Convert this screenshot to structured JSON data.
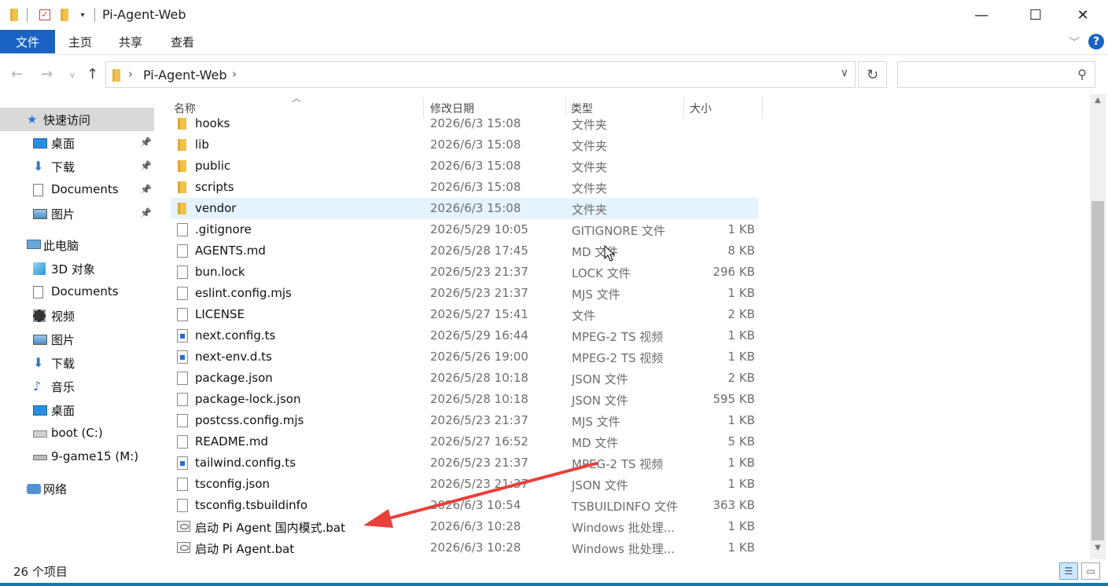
{
  "window": {
    "title": "Pi-Agent-Web",
    "minimize_glyph": "—",
    "maximize_glyph": "☐",
    "close_glyph": "✕"
  },
  "ribbon": {
    "tabs": [
      "文件",
      "主页",
      "共享",
      "查看"
    ],
    "active_color": "#1a63c2"
  },
  "address": {
    "path": "Pi-Agent-Web",
    "search_placeholder": ""
  },
  "sidebar": {
    "items": [
      {
        "label": "快速访问",
        "icon": "star-icon",
        "selected": true,
        "pinned": false
      },
      {
        "label": "桌面",
        "icon": "desktop-icon",
        "pinned": true
      },
      {
        "label": "下载",
        "icon": "download-icon",
        "pinned": true
      },
      {
        "label": "Documents",
        "icon": "documents-icon",
        "pinned": true
      },
      {
        "label": "图片",
        "icon": "pictures-icon",
        "pinned": true
      },
      {
        "label": "此电脑",
        "icon": "computer-icon",
        "pinned": false
      },
      {
        "label": "3D 对象",
        "icon": "3d-objects-icon",
        "pinned": false
      },
      {
        "label": "Documents",
        "icon": "documents-icon",
        "pinned": false
      },
      {
        "label": "视频",
        "icon": "video-icon",
        "pinned": false
      },
      {
        "label": "图片",
        "icon": "pictures-icon",
        "pinned": false
      },
      {
        "label": "下载",
        "icon": "download-icon",
        "pinned": false
      },
      {
        "label": "音乐",
        "icon": "music-icon",
        "pinned": false
      },
      {
        "label": "桌面",
        "icon": "desktop-icon",
        "pinned": false
      },
      {
        "label": "boot (C:)",
        "icon": "drive-c-icon",
        "pinned": false
      },
      {
        "label": "9-game15 (M:)",
        "icon": "drive-icon",
        "pinned": false
      },
      {
        "label": "网络",
        "icon": "network-icon",
        "pinned": false
      }
    ]
  },
  "columns": {
    "name": "名称",
    "date": "修改日期",
    "type": "类型",
    "size": "大小"
  },
  "files": [
    {
      "name": "hooks",
      "date": "2026/6/3 15:08",
      "type": "文件夹",
      "size": "",
      "icon": "folder"
    },
    {
      "name": "lib",
      "date": "2026/6/3 15:08",
      "type": "文件夹",
      "size": "",
      "icon": "folder"
    },
    {
      "name": "public",
      "date": "2026/6/3 15:08",
      "type": "文件夹",
      "size": "",
      "icon": "folder"
    },
    {
      "name": "scripts",
      "date": "2026/6/3 15:08",
      "type": "文件夹",
      "size": "",
      "icon": "folder"
    },
    {
      "name": "vendor",
      "date": "2026/6/3 15:08",
      "type": "文件夹",
      "size": "",
      "icon": "folder",
      "selected": true
    },
    {
      "name": ".gitignore",
      "date": "2026/5/29 10:05",
      "type": "GITIGNORE 文件",
      "size": "1 KB",
      "icon": "doc"
    },
    {
      "name": "AGENTS.md",
      "date": "2026/5/28 17:45",
      "type": "MD 文件",
      "size": "8 KB",
      "icon": "doc"
    },
    {
      "name": "bun.lock",
      "date": "2026/5/23 21:37",
      "type": "LOCK 文件",
      "size": "296 KB",
      "icon": "doc"
    },
    {
      "name": "eslint.config.mjs",
      "date": "2026/5/23 21:37",
      "type": "MJS 文件",
      "size": "1 KB",
      "icon": "doc"
    },
    {
      "name": "LICENSE",
      "date": "2026/5/27 15:41",
      "type": "文件",
      "size": "2 KB",
      "icon": "doc"
    },
    {
      "name": "next.config.ts",
      "date": "2026/5/29 16:44",
      "type": "MPEG-2 TS 视频",
      "size": "1 KB",
      "icon": "ts"
    },
    {
      "name": "next-env.d.ts",
      "date": "2026/5/26 19:00",
      "type": "MPEG-2 TS 视频",
      "size": "1 KB",
      "icon": "ts"
    },
    {
      "name": "package.json",
      "date": "2026/5/28 10:18",
      "type": "JSON 文件",
      "size": "2 KB",
      "icon": "doc"
    },
    {
      "name": "package-lock.json",
      "date": "2026/5/28 10:18",
      "type": "JSON 文件",
      "size": "595 KB",
      "icon": "doc"
    },
    {
      "name": "postcss.config.mjs",
      "date": "2026/5/23 21:37",
      "type": "MJS 文件",
      "size": "1 KB",
      "icon": "doc"
    },
    {
      "name": "README.md",
      "date": "2026/5/27 16:52",
      "type": "MD 文件",
      "size": "5 KB",
      "icon": "doc"
    },
    {
      "name": "tailwind.config.ts",
      "date": "2026/5/23 21:37",
      "type": "MPEG-2 TS 视频",
      "size": "1 KB",
      "icon": "ts"
    },
    {
      "name": "tsconfig.json",
      "date": "2026/5/23 21:37",
      "type": "JSON 文件",
      "size": "1 KB",
      "icon": "doc"
    },
    {
      "name": "tsconfig.tsbuildinfo",
      "date": "2026/6/3 10:54",
      "type": "TSBUILDINFO 文件",
      "size": "363 KB",
      "icon": "doc"
    },
    {
      "name": "启动 Pi Agent 国内模式.bat",
      "date": "2026/6/3 10:28",
      "type": "Windows 批处理...",
      "size": "1 KB",
      "icon": "bat"
    },
    {
      "name": "启动 Pi Agent.bat",
      "date": "2026/6/3 10:28",
      "type": "Windows 批处理...",
      "size": "1 KB",
      "icon": "bat"
    }
  ],
  "status": {
    "item_count": "26 个项目"
  },
  "annotation": {
    "arrow_color": "#e8403a"
  }
}
